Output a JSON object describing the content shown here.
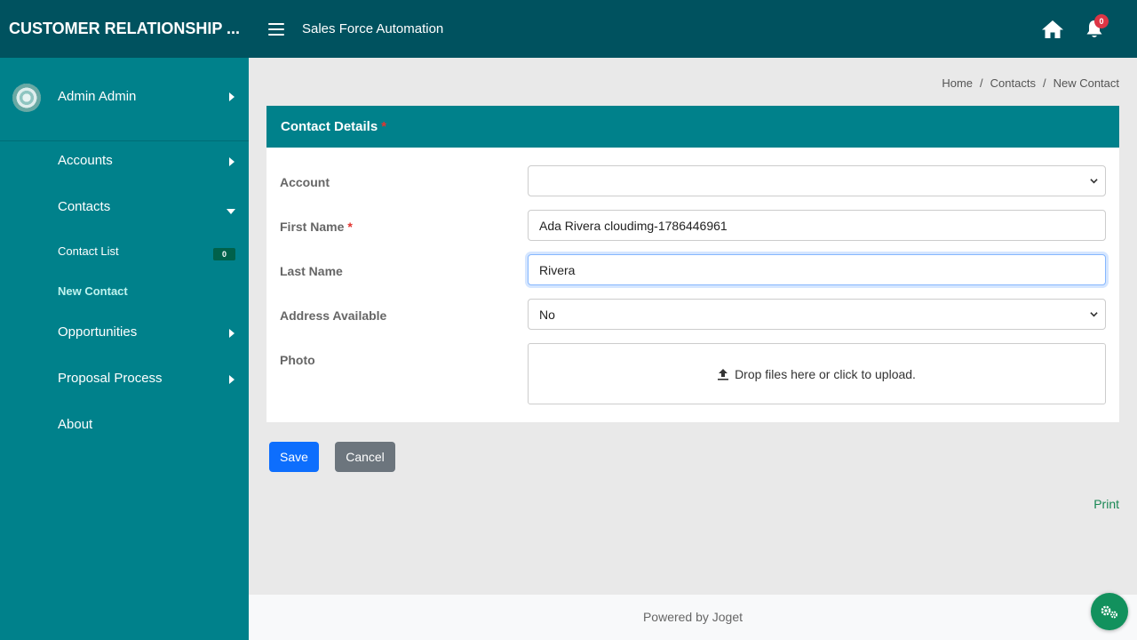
{
  "header": {
    "brand": "CUSTOMER RELATIONSHIP ...",
    "title": "Sales Force Automation",
    "notification_count": "0"
  },
  "sidebar": {
    "user": "Admin Admin",
    "items": [
      {
        "label": "Accounts"
      },
      {
        "label": "Contacts"
      },
      {
        "label": "Contact List",
        "badge": "0"
      },
      {
        "label": "New Contact"
      },
      {
        "label": "Opportunities"
      },
      {
        "label": "Proposal Process"
      },
      {
        "label": "About"
      }
    ]
  },
  "breadcrumb": [
    "Home",
    "Contacts",
    "New Contact"
  ],
  "form": {
    "title": "Contact Details",
    "required_mark": "*",
    "fields": {
      "account": {
        "label": "Account",
        "value": ""
      },
      "first_name": {
        "label": "First Name",
        "value": "Ada Rivera cloudimg-1786446961"
      },
      "last_name": {
        "label": "Last Name",
        "value": "Rivera"
      },
      "address": {
        "label": "Address Available",
        "value": "No"
      },
      "photo": {
        "label": "Photo",
        "dropzone_text": "Drop files here or click to upload."
      }
    }
  },
  "buttons": {
    "save": "Save",
    "cancel": "Cancel",
    "print": "Print"
  },
  "footer": {
    "text": "Powered by Joget"
  },
  "icons": [
    "menu-icon",
    "home-icon",
    "bell-icon",
    "avatar",
    "upload-icon",
    "gears-icon"
  ],
  "colors": {
    "header": "#00525f",
    "sidebar": "#00818b",
    "save": "#0d6efd",
    "cancel": "#6c757d",
    "fab": "#12915d"
  }
}
